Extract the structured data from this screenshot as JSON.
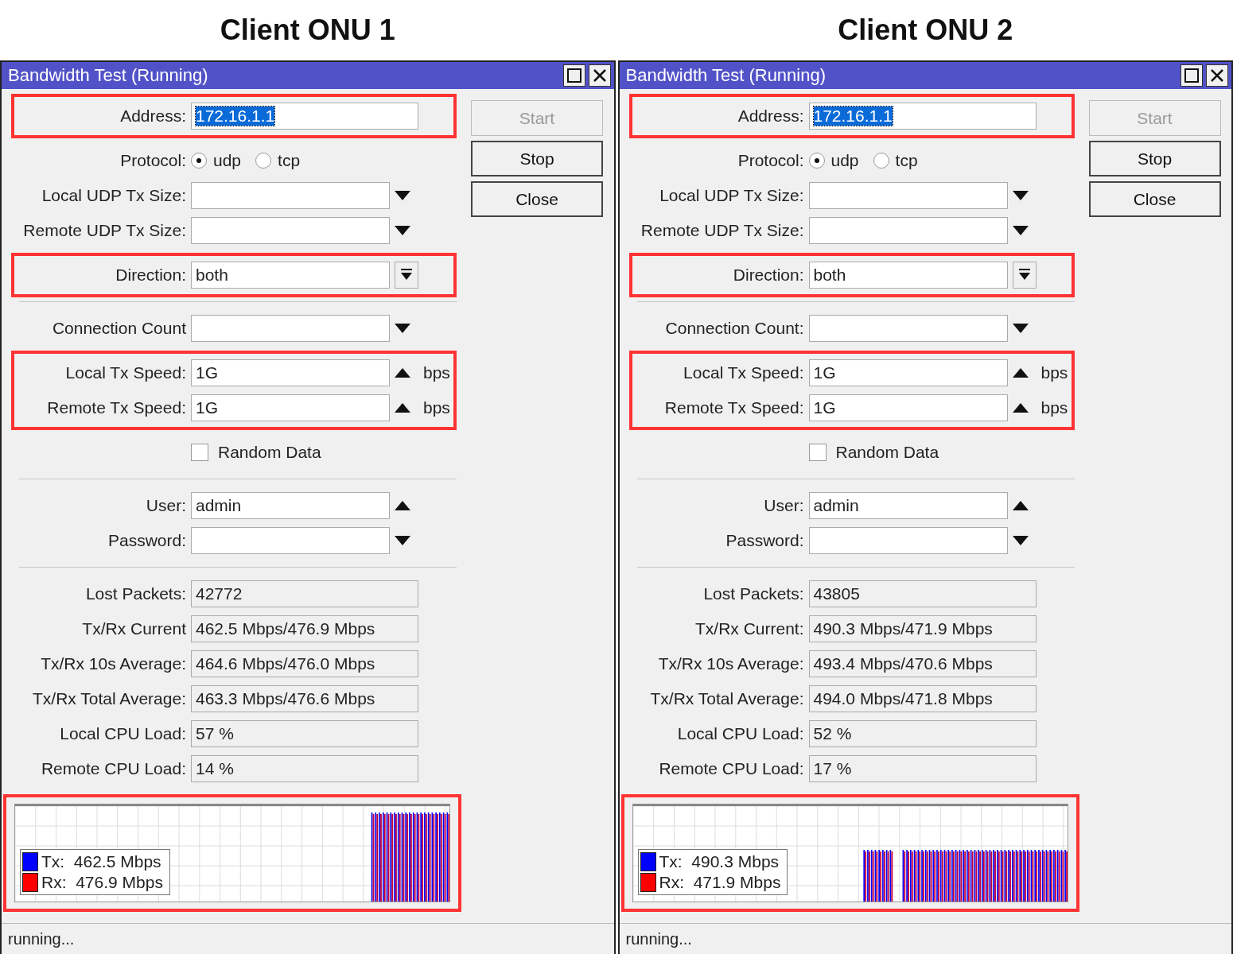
{
  "panels": [
    {
      "heading": "Client ONU 1",
      "window": {
        "title": "Bandwidth Test (Running)",
        "buttons": [
          {
            "label": "Start",
            "disabled": true
          },
          {
            "label": "Stop",
            "disabled": false
          },
          {
            "label": "Close",
            "disabled": false
          }
        ],
        "sections": [
          [
            {
              "highlighted": true,
              "rows": [
                {
                  "kind": "text",
                  "label": "Address:",
                  "value": "172.16.1.1",
                  "value_selected": true
                }
              ]
            },
            {
              "highlighted": false,
              "rows": [
                {
                  "kind": "radio",
                  "label": "Protocol:",
                  "options": [
                    {
                      "label": "udp",
                      "selected": true
                    },
                    {
                      "label": "tcp",
                      "selected": false
                    }
                  ]
                },
                {
                  "kind": "dropdown",
                  "label": "Local UDP Tx Size:",
                  "arrow_up": false
                },
                {
                  "kind": "dropdown",
                  "label": "Remote UDP Tx Size:",
                  "arrow_up": false
                }
              ]
            },
            {
              "highlighted": true,
              "rows": [
                {
                  "kind": "select",
                  "label": "Direction:",
                  "value": "both"
                }
              ]
            }
          ],
          [
            {
              "highlighted": false,
              "rows": [
                {
                  "kind": "dropdown",
                  "label": "Connection Count",
                  "arrow_up": false
                }
              ]
            },
            {
              "highlighted": true,
              "rows": [
                {
                  "kind": "spin",
                  "label": "Local Tx Speed:",
                  "value": "1G",
                  "unit": "bps"
                },
                {
                  "kind": "spin",
                  "label": "Remote Tx Speed:",
                  "value": "1G",
                  "unit": "bps"
                }
              ]
            },
            {
              "highlighted": false,
              "rows": [
                {
                  "kind": "checkbox",
                  "label": "Random Data",
                  "checked": false
                }
              ]
            }
          ],
          [
            {
              "highlighted": false,
              "rows": [
                {
                  "kind": "dropdown",
                  "label": "User:",
                  "value": "admin",
                  "arrow_up": true
                },
                {
                  "kind": "dropdown",
                  "label": "Password:",
                  "arrow_up": false
                }
              ]
            }
          ],
          [
            {
              "highlighted": false,
              "rows": [
                {
                  "kind": "readonly",
                  "label": "Lost Packets:",
                  "value": "42772"
                },
                {
                  "kind": "readonly",
                  "label": "Tx/Rx Current",
                  "value": "462.5 Mbps/476.9 Mbps"
                },
                {
                  "kind": "readonly",
                  "label": "Tx/Rx 10s Average:",
                  "value": "464.6 Mbps/476.0 Mbps"
                },
                {
                  "kind": "readonly",
                  "label": "Tx/Rx Total Average:",
                  "value": "463.3 Mbps/476.6 Mbps"
                },
                {
                  "kind": "readonly",
                  "label": "Local CPU Load:",
                  "value": "57 %"
                },
                {
                  "kind": "readonly",
                  "label": "Remote CPU Load:",
                  "value": "14 %"
                }
              ]
            }
          ]
        ],
        "graph": {
          "highlighted": true,
          "legend": [
            {
              "label": "Tx:",
              "value": "462.5 Mbps",
              "color": "#0000ff"
            },
            {
              "label": "Rx:",
              "value": "476.9 Mbps",
              "color": "#ff0000"
            }
          ]
        },
        "status": "running..."
      }
    },
    {
      "heading": "Client ONU 2",
      "window": {
        "title": "Bandwidth Test (Running)",
        "buttons": [
          {
            "label": "Start",
            "disabled": true
          },
          {
            "label": "Stop",
            "disabled": false
          },
          {
            "label": "Close",
            "disabled": false
          }
        ],
        "sections": [
          [
            {
              "highlighted": true,
              "rows": [
                {
                  "kind": "text",
                  "label": "Address:",
                  "value": "172.16.1.1",
                  "value_selected": true
                }
              ]
            },
            {
              "highlighted": false,
              "rows": [
                {
                  "kind": "radio",
                  "label": "Protocol:",
                  "options": [
                    {
                      "label": "udp",
                      "selected": true
                    },
                    {
                      "label": "tcp",
                      "selected": false
                    }
                  ]
                },
                {
                  "kind": "dropdown",
                  "label": "Local UDP Tx Size:",
                  "arrow_up": false
                },
                {
                  "kind": "dropdown",
                  "label": "Remote UDP Tx Size:",
                  "arrow_up": false
                }
              ]
            },
            {
              "highlighted": true,
              "rows": [
                {
                  "kind": "select",
                  "label": "Direction:",
                  "value": "both"
                }
              ]
            }
          ],
          [
            {
              "highlighted": false,
              "rows": [
                {
                  "kind": "dropdown",
                  "label": "Connection Count:",
                  "arrow_up": false
                }
              ]
            },
            {
              "highlighted": true,
              "rows": [
                {
                  "kind": "spin",
                  "label": "Local Tx Speed:",
                  "value": "1G",
                  "unit": "bps"
                },
                {
                  "kind": "spin",
                  "label": "Remote Tx Speed:",
                  "value": "1G",
                  "unit": "bps"
                }
              ]
            },
            {
              "highlighted": false,
              "rows": [
                {
                  "kind": "checkbox",
                  "label": "Random Data",
                  "checked": false
                }
              ]
            }
          ],
          [
            {
              "highlighted": false,
              "rows": [
                {
                  "kind": "dropdown",
                  "label": "User:",
                  "value": "admin",
                  "arrow_up": true
                },
                {
                  "kind": "dropdown",
                  "label": "Password:",
                  "arrow_up": false
                }
              ]
            }
          ],
          [
            {
              "highlighted": false,
              "rows": [
                {
                  "kind": "readonly",
                  "label": "Lost Packets:",
                  "value": "43805"
                },
                {
                  "kind": "readonly",
                  "label": "Tx/Rx Current:",
                  "value": "490.3 Mbps/471.9 Mbps"
                },
                {
                  "kind": "readonly",
                  "label": "Tx/Rx 10s Average:",
                  "value": "493.4 Mbps/470.6 Mbps"
                },
                {
                  "kind": "readonly",
                  "label": "Tx/Rx Total Average:",
                  "value": "494.0 Mbps/471.8 Mbps"
                },
                {
                  "kind": "readonly",
                  "label": "Local CPU Load:",
                  "value": "52 %"
                },
                {
                  "kind": "readonly",
                  "label": "Remote CPU Load:",
                  "value": "17 %"
                }
              ]
            }
          ]
        ],
        "graph": {
          "highlighted": true,
          "legend": [
            {
              "label": "Tx:",
              "value": "490.3 Mbps",
              "color": "#0000ff"
            },
            {
              "label": "Rx:",
              "value": "471.9 Mbps",
              "color": "#ff0000"
            }
          ]
        },
        "status": "running..."
      }
    }
  ]
}
